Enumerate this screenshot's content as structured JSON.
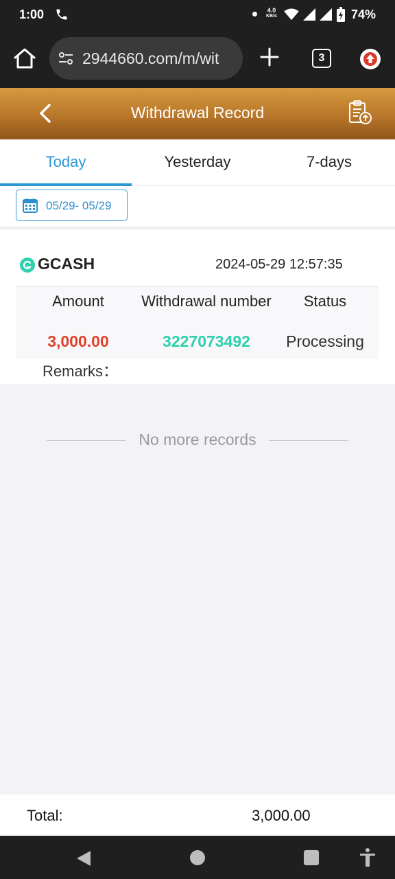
{
  "status_bar": {
    "time": "1:00",
    "network_speed_value": "4.0",
    "network_speed_unit": "KB/s",
    "battery": "74%"
  },
  "browser": {
    "url": "2944660.com/m/wit",
    "tab_count": "3"
  },
  "header": {
    "title": "Withdrawal Record"
  },
  "tabs": [
    {
      "label": "Today",
      "active": true
    },
    {
      "label": "Yesterday",
      "active": false
    },
    {
      "label": "7-days",
      "active": false
    }
  ],
  "date_filter": {
    "range": "05/29- 05/29"
  },
  "record": {
    "method": "GCASH",
    "datetime": "2024-05-29 12:57:35",
    "columns": {
      "amount": "Amount",
      "number": "Withdrawal number",
      "status": "Status"
    },
    "amount": "3,000.00",
    "number": "3227073492",
    "status": "Processing",
    "remarks_label": "Remarks："
  },
  "footer_message": "No more records",
  "total": {
    "label": "Total:",
    "value": "3,000.00"
  },
  "colors": {
    "header_gradient_top": "#d69a3e",
    "header_gradient_bottom": "#8f5618",
    "accent_blue": "#2b97d4",
    "amount_red": "#e2412c",
    "number_teal": "#2fd0ad"
  }
}
